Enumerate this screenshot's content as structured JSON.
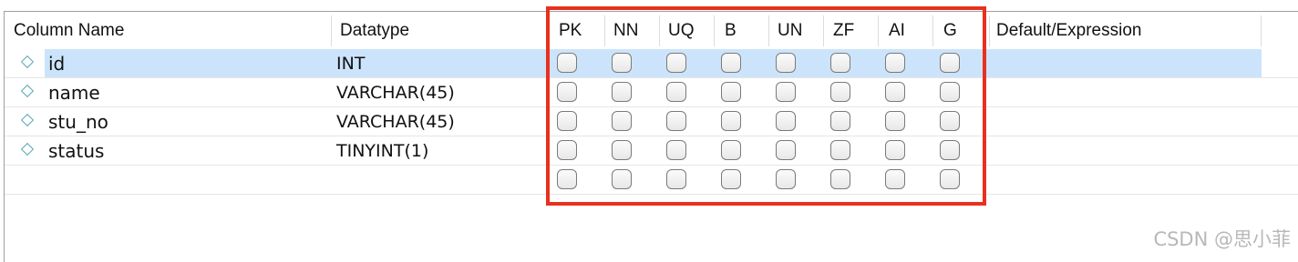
{
  "table": {
    "columns": {
      "name": "Column Name",
      "datatype": "Datatype",
      "pk": "PK",
      "nn": "NN",
      "uq": "UQ",
      "b": "B",
      "un": "UN",
      "zf": "ZF",
      "ai": "AI",
      "g": "G",
      "default": "Default/Expression"
    },
    "rows": [
      {
        "name": "id",
        "datatype": "INT",
        "selected": true
      },
      {
        "name": "name",
        "datatype": "VARCHAR(45)"
      },
      {
        "name": "stu_no",
        "datatype": "VARCHAR(45)"
      },
      {
        "name": "status",
        "datatype": "TINYINT(1)"
      },
      {
        "name": "",
        "datatype": ""
      }
    ],
    "flag_columns": [
      "pk",
      "nn",
      "uq",
      "b",
      "un",
      "zf",
      "ai",
      "g"
    ]
  },
  "colors": {
    "selection": "#cce4fb",
    "highlight_box": "#e8301f",
    "column_icon": "#5aa6b8"
  },
  "icons": {
    "column": "diamond-column-icon"
  },
  "watermark": "CSDN @思小菲"
}
